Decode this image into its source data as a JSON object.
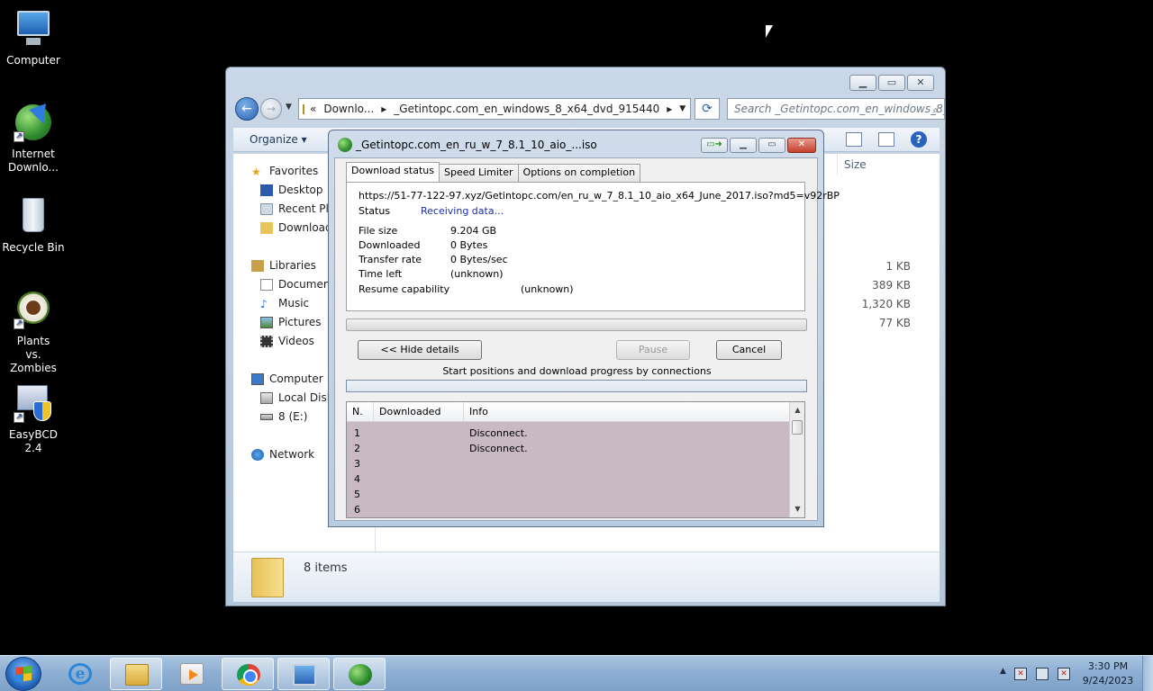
{
  "desktop": {
    "icons": [
      {
        "label": "Computer"
      },
      {
        "label": "Internet Downlo..."
      },
      {
        "label": "Recycle Bin"
      },
      {
        "label": "Plants vs. Zombies"
      },
      {
        "label": "EasyBCD 2.4"
      }
    ]
  },
  "explorer": {
    "breadcrumb": {
      "sep": "«",
      "parent": "Downlo...",
      "current": "_Getintopc.com_en_windows_8_x64_dvd_915440"
    },
    "search_placeholder": "Search _Getintopc.com_en_windows_8_...",
    "organize_label": "Organize",
    "nav": {
      "favorites": "Favorites",
      "desktop": "Desktop",
      "recent": "Recent Pla",
      "downloads": "Download",
      "libraries": "Libraries",
      "documents": "Document",
      "music": "Music",
      "pictures": "Pictures",
      "videos": "Videos",
      "computer": "Computer",
      "local_disk": "Local Disk",
      "drive_e": "8 (E:)",
      "network": "Network"
    },
    "size_header": "Size",
    "sizes": [
      "1 KB",
      "389 KB",
      "1,320 KB",
      "77 KB"
    ],
    "item_count": "8 items"
  },
  "idm": {
    "title": "_Getintopc.com_en_ru_w_7_8.1_10_aio_...iso",
    "tabs": [
      "Download status",
      "Speed Limiter",
      "Options on completion"
    ],
    "url": "https://51-77-122-97.xyz/Getintopc.com/en_ru_w_7_8.1_10_aio_x64_June_2017.iso?md5=v92rBP",
    "status_label": "Status",
    "status_value": "Receiving data...",
    "file_size_label": "File size",
    "file_size_value": "9.204  GB",
    "downloaded_label": "Downloaded",
    "downloaded_value": "0 Bytes",
    "transfer_rate_label": "Transfer rate",
    "transfer_rate_value": "0  Bytes/sec",
    "time_left_label": "Time left",
    "time_left_value": "(unknown)",
    "resume_label": "Resume capability",
    "resume_value": "(unknown)",
    "progress": 0,
    "hide_details_label": "<< Hide details",
    "pause_label": "Pause",
    "cancel_label": "Cancel",
    "connections_caption": "Start positions and download progress by connections",
    "table_headers": [
      "N.",
      "Downloaded",
      "Info"
    ],
    "rows": [
      {
        "n": "1",
        "downloaded": "",
        "info": "Disconnect."
      },
      {
        "n": "2",
        "downloaded": "",
        "info": "Disconnect."
      },
      {
        "n": "3",
        "downloaded": "",
        "info": ""
      },
      {
        "n": "4",
        "downloaded": "",
        "info": ""
      },
      {
        "n": "5",
        "downloaded": "",
        "info": ""
      },
      {
        "n": "6",
        "downloaded": "",
        "info": ""
      }
    ]
  },
  "taskbar": {
    "clock_time": "3:30 PM",
    "clock_date": "9/24/2023"
  }
}
